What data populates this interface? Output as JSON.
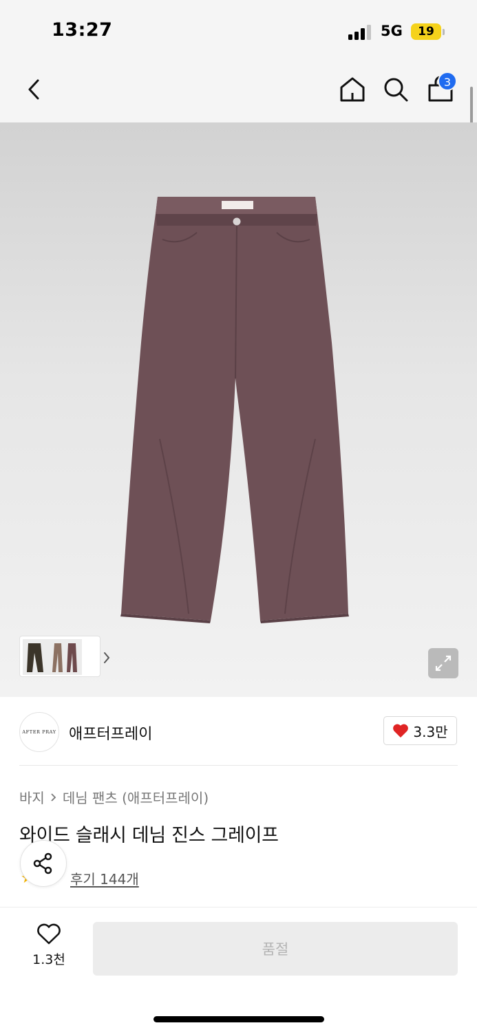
{
  "status_bar": {
    "time": "13:27",
    "network": "5G",
    "battery": "19"
  },
  "nav": {
    "cart_count": "3"
  },
  "brand": {
    "logo_text": "AFTER PRAY",
    "name": "애프터프레이",
    "like_count": "3.3만"
  },
  "product": {
    "breadcrumb": [
      "바지",
      "데님 팬츠 (애프터프레이)"
    ],
    "title": "와이드 슬래시 데님 진스 그레이프",
    "review_label": "후기 144개"
  },
  "bottom": {
    "wish_count": "1.3천",
    "buy_label": "품절"
  },
  "colors": {
    "accent_blue": "#1f6bf0",
    "heart_red": "#e02424",
    "star_yellow": "#f5b400",
    "denim_grape": "#6e5056"
  },
  "icons": [
    "back-icon",
    "home-icon",
    "search-icon",
    "bag-icon",
    "chevron-right-icon",
    "expand-icon",
    "heart-icon",
    "share-icon",
    "star-icon"
  ]
}
